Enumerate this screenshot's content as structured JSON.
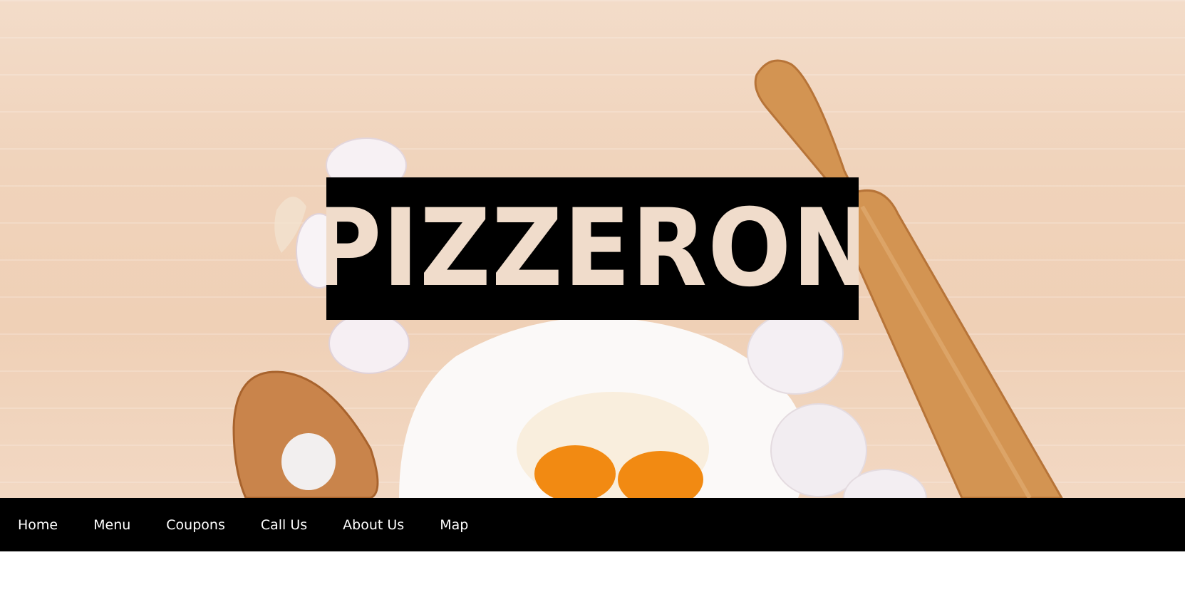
{
  "hero": {
    "background_image": "wooden-table-baking-ingredients",
    "logo_text": "PIZZERON"
  },
  "nav": {
    "items": [
      {
        "label": "Home"
      },
      {
        "label": "Menu"
      },
      {
        "label": "Coupons"
      },
      {
        "label": "Call Us"
      },
      {
        "label": "About Us"
      },
      {
        "label": "Map"
      }
    ]
  },
  "colors": {
    "nav_background": "#000000",
    "nav_text": "#ffffff",
    "logo_background": "#000000",
    "page_background": "#ffffff"
  }
}
